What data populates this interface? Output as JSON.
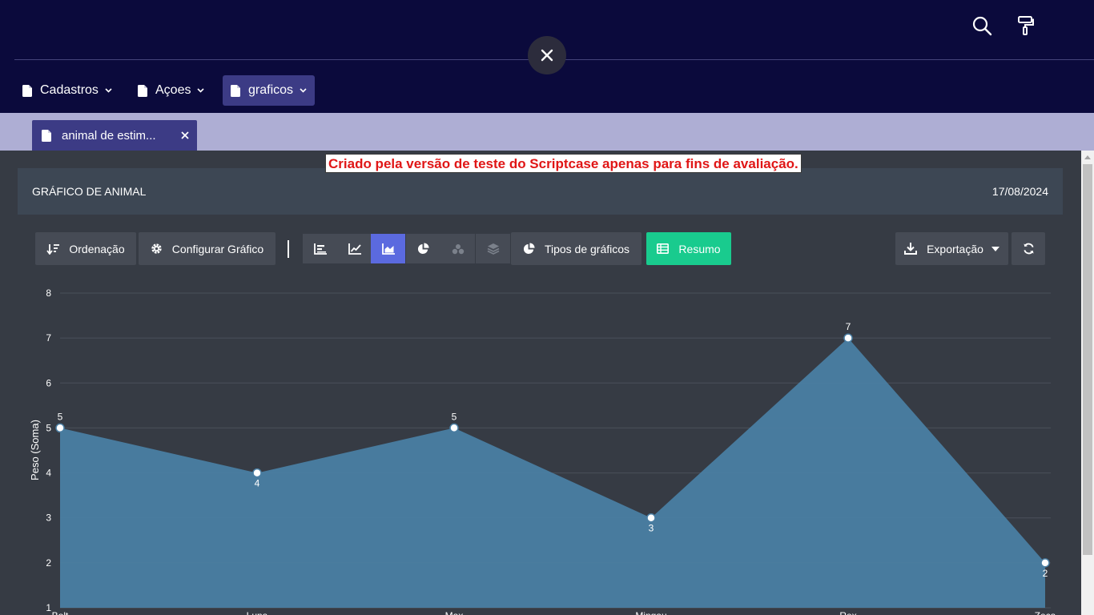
{
  "menu": {
    "items": [
      {
        "label": "Cadastros"
      },
      {
        "label": "Açoes"
      },
      {
        "label": "graficos"
      }
    ]
  },
  "tab": {
    "label": "animal de estimação"
  },
  "banner": "Criado pela versão de teste do Scriptcase apenas para fins de avaliação.",
  "panel": {
    "title": "GRÁFICO DE ANIMAL",
    "date": "17/08/2024"
  },
  "toolbar": {
    "ordenacao": "Ordenação",
    "configurar": "Configurar Gráfico",
    "tipos": "Tipos de gráficos",
    "resumo": "Resumo",
    "exportacao": "Exportação"
  },
  "colors": {
    "header": "#0b0a3c",
    "accent": "#5b6adf",
    "resumo": "#19cb8e",
    "area": "#4a7ea3",
    "trial_text": "#e01616"
  },
  "chart_data": {
    "type": "area",
    "ylabel": "Peso (Soma)",
    "ylim": [
      1,
      8
    ],
    "yticks": [
      1,
      2,
      3,
      4,
      5,
      6,
      7,
      8
    ],
    "categories": [
      "Bolt",
      "Luna",
      "Max",
      "Mingau",
      "Rex",
      "Zeca"
    ],
    "series": [
      {
        "values": [
          5,
          4,
          5,
          3,
          7,
          2
        ]
      }
    ],
    "grid": true
  }
}
